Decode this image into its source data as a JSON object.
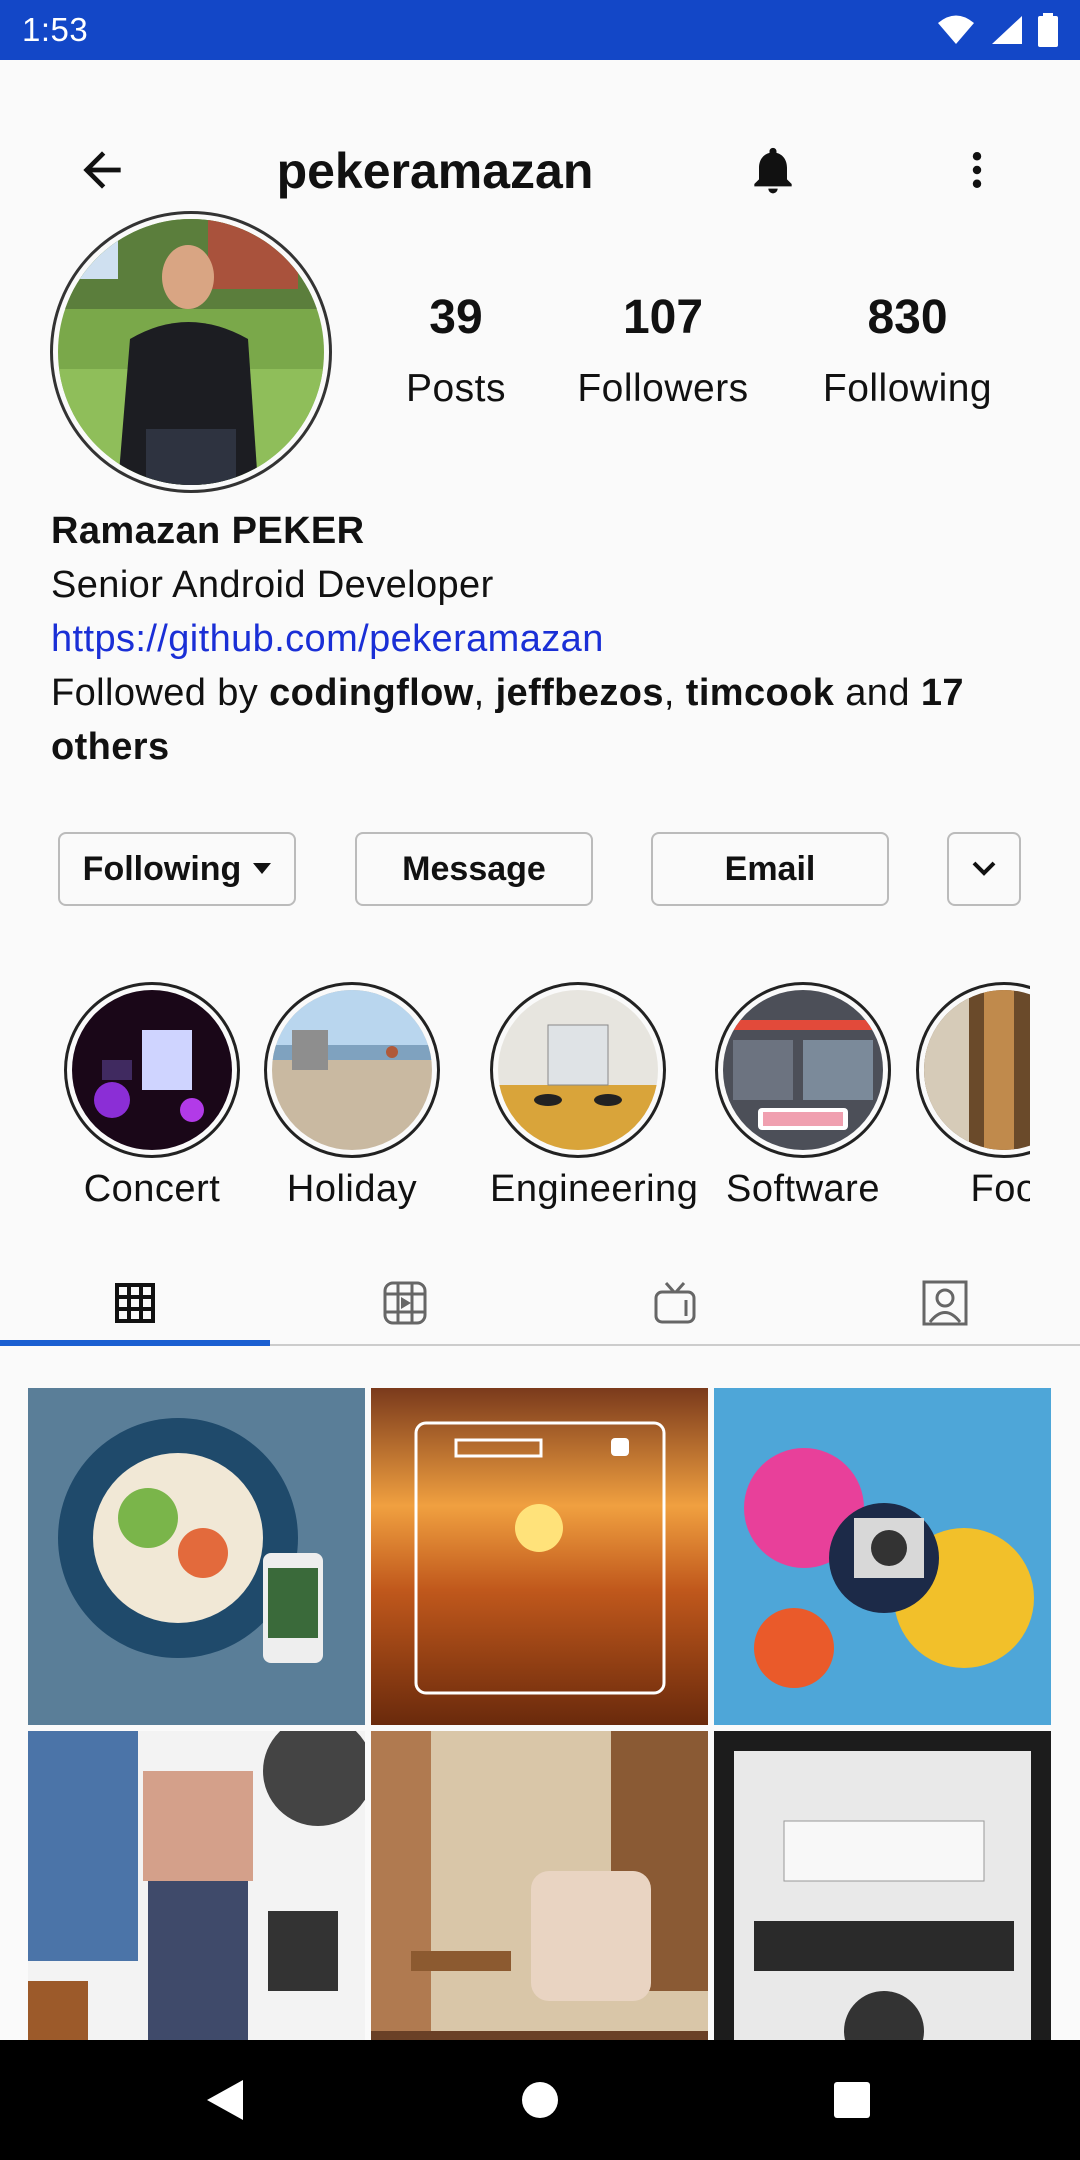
{
  "status_bar": {
    "time": "1:53"
  },
  "header": {
    "username": "pekeramazan"
  },
  "profile": {
    "stats": [
      {
        "count": "39",
        "label": "Posts"
      },
      {
        "count": "107",
        "label": "Followers"
      },
      {
        "count": "830",
        "label": "Following"
      }
    ],
    "name": "Ramazan PEKER",
    "bio": "Senior Android Developer",
    "link": "https://github.com/pekeramazan",
    "followed_by": {
      "prefix": "Followed by ",
      "users": [
        "codingflow",
        "jeffbezos",
        "timcook"
      ],
      "and": " and ",
      "others": "17 others",
      "separator": ", "
    }
  },
  "actions": {
    "following": "Following",
    "message": "Message",
    "email": "Email"
  },
  "highlights": [
    {
      "label": "Concert"
    },
    {
      "label": "Holiday"
    },
    {
      "label": "Engineering"
    },
    {
      "label": "Software"
    },
    {
      "label": "Foo"
    }
  ],
  "tabs": [
    "grid-icon",
    "reels-icon",
    "tv-icon",
    "tagged-icon"
  ],
  "colors": {
    "status_bar": "#1347c7",
    "link": "#1a2fd6",
    "tab_indicator": "#1b5fd1"
  }
}
